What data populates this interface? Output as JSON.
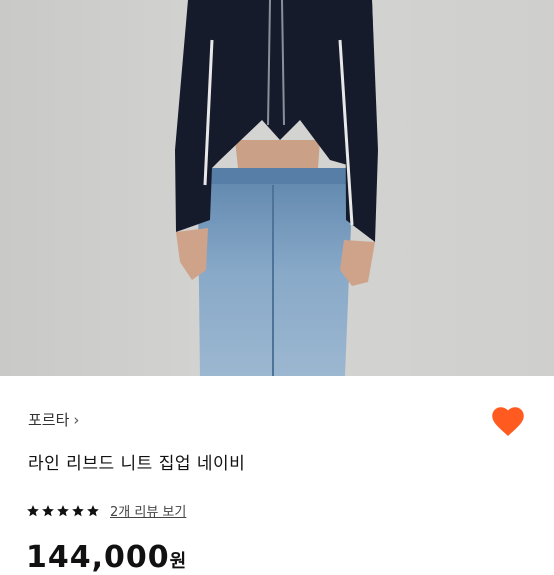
{
  "product": {
    "brand": "포르타",
    "title": "라인 리브드 니트 집업 네이비",
    "rating": 5,
    "review_link": "2개 리뷰 보기",
    "price": "144,000",
    "price_unit": "원"
  },
  "icons": {
    "brand_chevron": "chevron-right-icon",
    "wishlist": "heart-icon",
    "star": "star-icon"
  },
  "colors": {
    "heart": "#ff5a1f",
    "star": "#111111"
  }
}
